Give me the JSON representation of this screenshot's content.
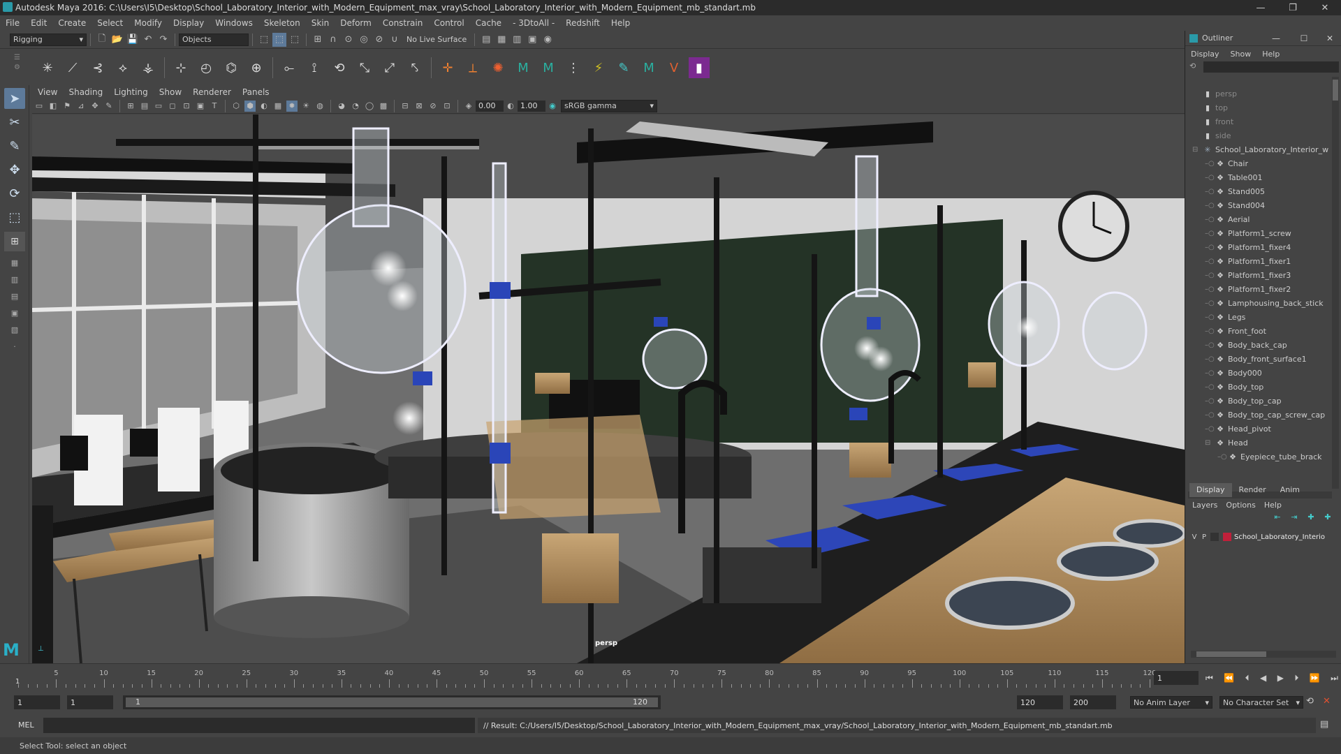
{
  "window": {
    "title": "Autodesk Maya 2016: C:\\Users\\I5\\Desktop\\School_Laboratory_Interior_with_Modern_Equipment_max_vray\\School_Laboratory_Interior_with_Modern_Equipment_mb_standart.mb",
    "minimize": "—",
    "restore": "❐",
    "close": "✕"
  },
  "menubar": [
    "File",
    "Edit",
    "Create",
    "Select",
    "Modify",
    "Display",
    "Windows",
    "Skeleton",
    "Skin",
    "Deform",
    "Constrain",
    "Control",
    "Cache",
    "- 3DtoAll -",
    "Redshift",
    "Help"
  ],
  "statusline": {
    "mode": "Rigging",
    "selection_mode": "Objects",
    "live_surface": "No Live Surface"
  },
  "viewport": {
    "menus": [
      "View",
      "Shading",
      "Lighting",
      "Show",
      "Renderer",
      "Panels"
    ],
    "exposure": "0.00",
    "gamma": "1.00",
    "color_space": "sRGB gamma",
    "camera_label": "persp"
  },
  "outliner": {
    "title": "Outliner",
    "menus": [
      "Display",
      "Show",
      "Help"
    ],
    "items": [
      {
        "label": "persp",
        "type": "camera",
        "indent": 0
      },
      {
        "label": "top",
        "type": "camera",
        "indent": 0
      },
      {
        "label": "front",
        "type": "camera",
        "indent": 0
      },
      {
        "label": "side",
        "type": "camera",
        "indent": 0
      },
      {
        "label": "School_Laboratory_Interior_w",
        "type": "root",
        "indent": 0
      },
      {
        "label": "Chair",
        "type": "mesh",
        "indent": 1
      },
      {
        "label": "Table001",
        "type": "mesh",
        "indent": 1
      },
      {
        "label": "Stand005",
        "type": "mesh",
        "indent": 1
      },
      {
        "label": "Stand004",
        "type": "mesh",
        "indent": 1
      },
      {
        "label": "Aerial",
        "type": "mesh",
        "indent": 1
      },
      {
        "label": "Platform1_screw",
        "type": "mesh",
        "indent": 1
      },
      {
        "label": "Platform1_fixer4",
        "type": "mesh",
        "indent": 1
      },
      {
        "label": "Platform1_fixer1",
        "type": "mesh",
        "indent": 1
      },
      {
        "label": "Platform1_fixer3",
        "type": "mesh",
        "indent": 1
      },
      {
        "label": "Platform1_fixer2",
        "type": "mesh",
        "indent": 1
      },
      {
        "label": "Lamphousing_back_stick",
        "type": "mesh",
        "indent": 1
      },
      {
        "label": "Legs",
        "type": "mesh",
        "indent": 1
      },
      {
        "label": "Front_foot",
        "type": "mesh",
        "indent": 1
      },
      {
        "label": "Body_back_cap",
        "type": "mesh",
        "indent": 1
      },
      {
        "label": "Body_front_surface1",
        "type": "mesh",
        "indent": 1
      },
      {
        "label": "Body000",
        "type": "mesh",
        "indent": 1
      },
      {
        "label": "Body_top",
        "type": "mesh",
        "indent": 1
      },
      {
        "label": "Body_top_cap",
        "type": "mesh",
        "indent": 1
      },
      {
        "label": "Body_top_cap_screw_cap",
        "type": "mesh",
        "indent": 1
      },
      {
        "label": "Head_pivot",
        "type": "mesh",
        "indent": 1
      },
      {
        "label": "Head",
        "type": "group",
        "indent": 1
      },
      {
        "label": "Eyepiece_tube_brack",
        "type": "mesh",
        "indent": 2
      }
    ]
  },
  "layer_editor": {
    "tabs": [
      "Display",
      "Render",
      "Anim"
    ],
    "menus": [
      "Layers",
      "Options",
      "Help"
    ],
    "layer": {
      "v": "V",
      "p": "P",
      "name": "School_Laboratory_Interio",
      "color": "#c0203a"
    }
  },
  "timeline": {
    "ticks": [
      5,
      10,
      15,
      20,
      25,
      30,
      35,
      40,
      45,
      50,
      55,
      60,
      65,
      70,
      75,
      80,
      85,
      90,
      95,
      100,
      105,
      110,
      115,
      120
    ],
    "start_label": "1",
    "current_frame": "1"
  },
  "range": {
    "start": "1",
    "start_inner": "1",
    "slider_start": "1",
    "slider_end": "120",
    "end_inner": "120",
    "end": "200",
    "anim_layer": "No Anim Layer",
    "character_set": "No Character Set"
  },
  "command": {
    "lang": "MEL",
    "result": "// Result: C:/Users/I5/Desktop/School_Laboratory_Interior_with_Modern_Equipment_max_vray/School_Laboratory_Interior_with_Modern_Equipment_mb_standart.mb"
  },
  "helpline": "Select Tool: select an object",
  "colors": {
    "accent": "#5d7a9a",
    "panel": "#444444",
    "field": "#2b2b2b",
    "chalkboard": "#243326",
    "counter": "#1e1e1e",
    "cabinet": "#b08c5e"
  }
}
